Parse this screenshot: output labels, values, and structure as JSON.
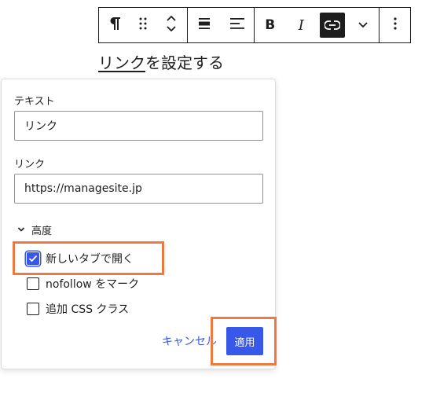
{
  "toolbar": {
    "paragraph_icon": "pilcrow-icon",
    "drag_icon": "drag-handle-icon",
    "move_icon": "chevron-up-down-icon",
    "align_icon": "align-center-icon",
    "text_align_icon": "align-left-icon",
    "bold_label": "B",
    "italic_label": "I",
    "link_icon": "link-icon",
    "more_formats_icon": "chevron-down-icon",
    "options_icon": "more-vertical-icon"
  },
  "content": {
    "link_text": "リンク",
    "rest_text": "を設定する"
  },
  "popover": {
    "text_label": "テキスト",
    "text_value": "リンク",
    "link_label": "リンク",
    "link_value": "https://managesite.jp",
    "advanced_label": "高度",
    "options": [
      {
        "label": "新しいタブで開く",
        "checked": true
      },
      {
        "label": "nofollow をマーク",
        "checked": false
      },
      {
        "label": "追加 CSS クラス",
        "checked": false
      }
    ],
    "cancel_label": "キャンセル",
    "apply_label": "適用"
  },
  "colors": {
    "accent": "#3858e9",
    "highlight": "#ee7a40",
    "text": "#1e1e1e"
  }
}
